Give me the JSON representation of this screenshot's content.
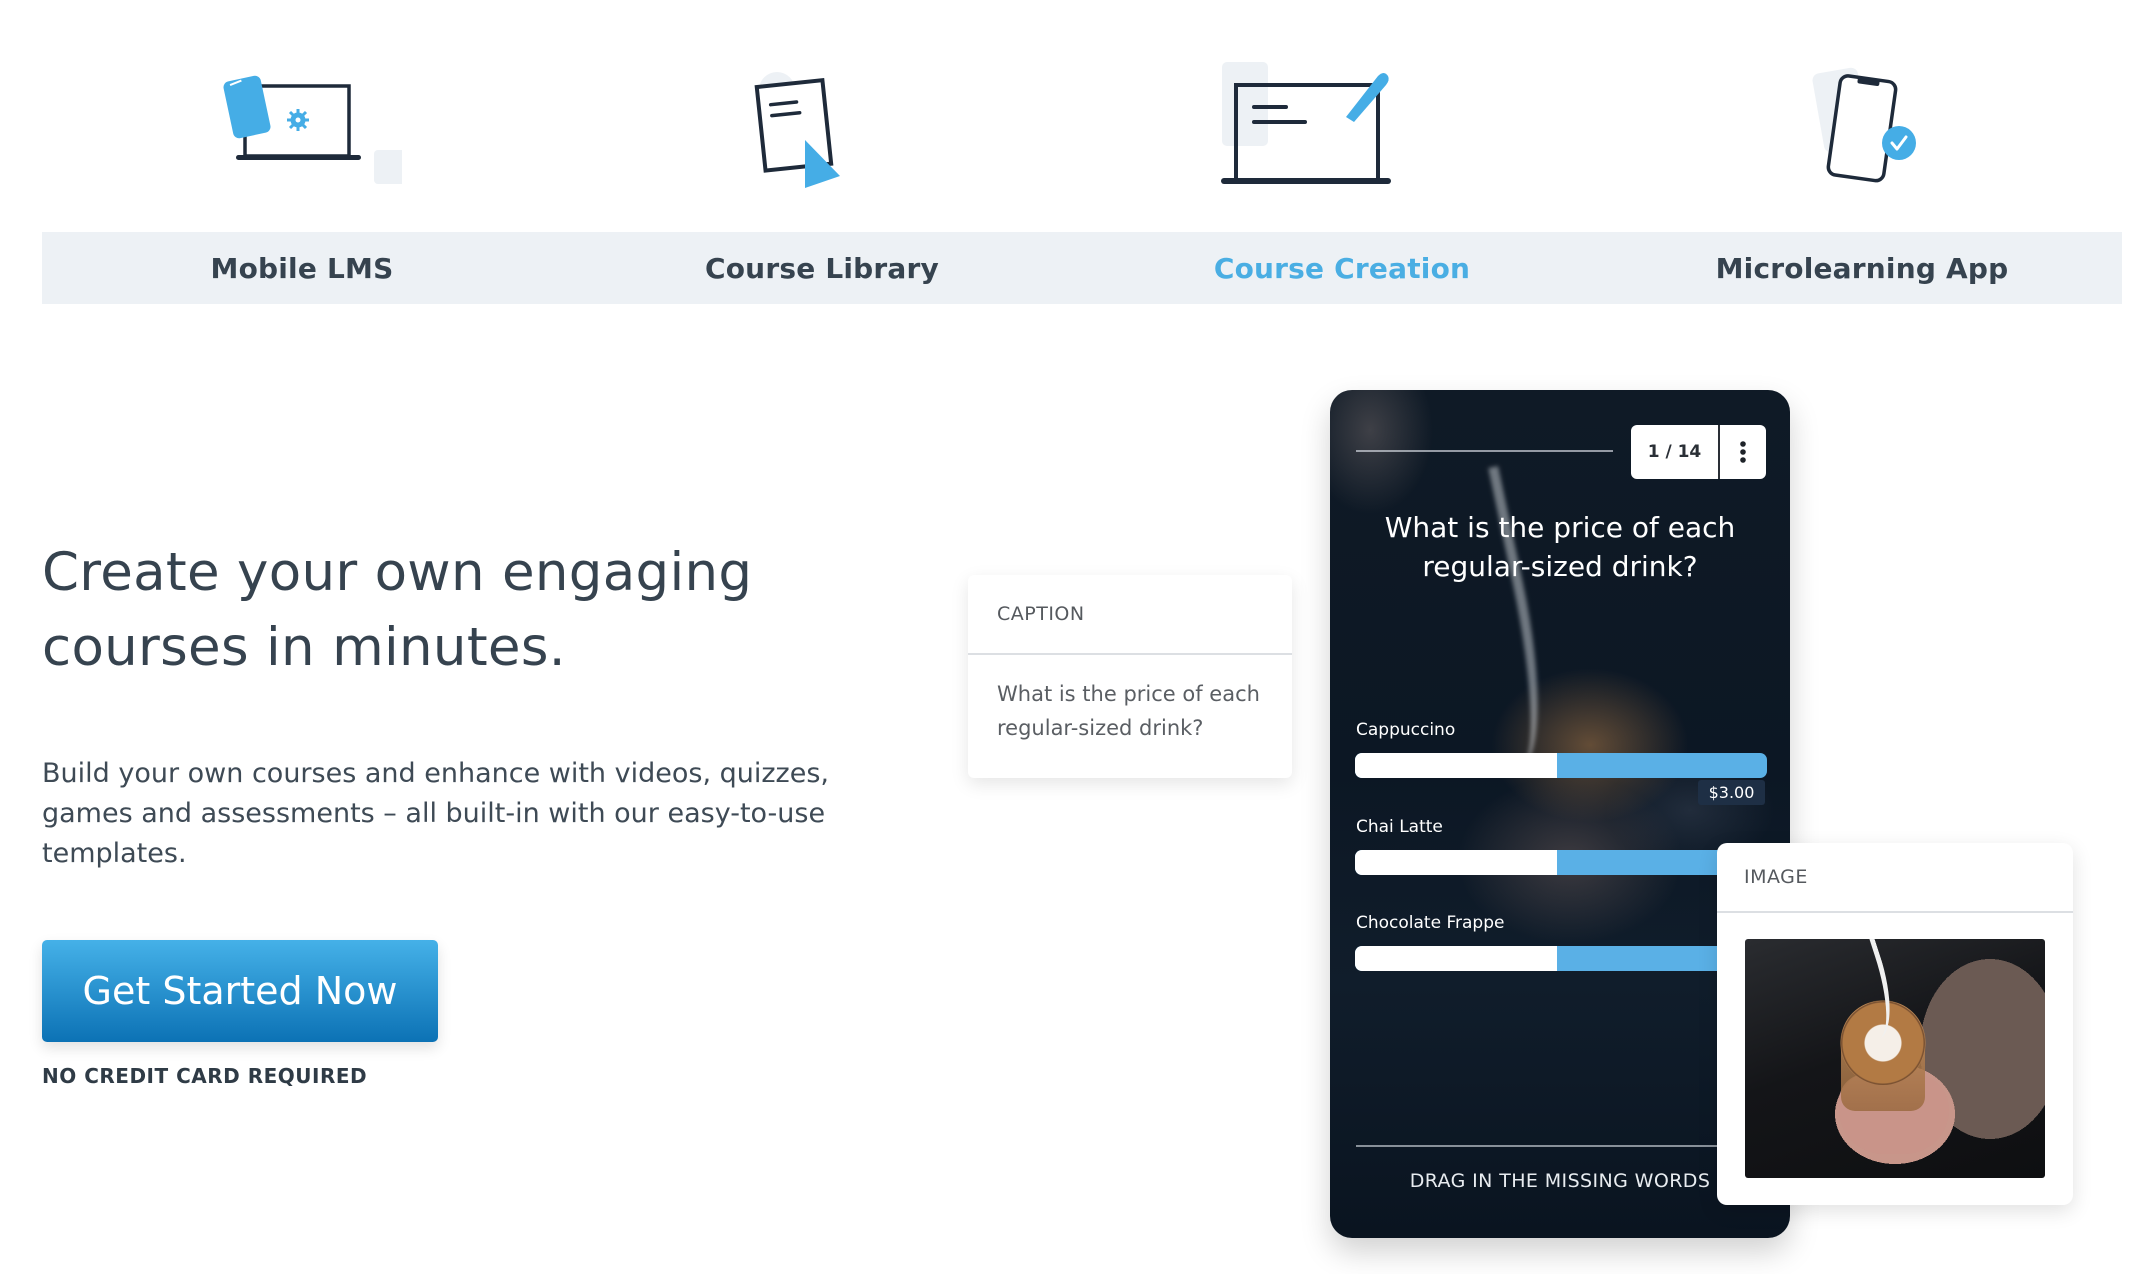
{
  "product_tabs": [
    {
      "label": "Mobile LMS",
      "icon": "laptop-phone-gear-icon",
      "active": false
    },
    {
      "label": "Course Library",
      "icon": "document-cursor-icon",
      "active": false
    },
    {
      "label": "Course Creation",
      "icon": "laptop-pen-icon",
      "active": true
    },
    {
      "label": "Microlearning App",
      "icon": "phone-check-icon",
      "active": false
    }
  ],
  "hero": {
    "title_line1": "Create your own engaging",
    "title_line2": "courses in minutes.",
    "body_line1": "Build your own courses and enhance with videos, quizzes,",
    "body_line2": "games and assessments – all built-in with our easy-to-use",
    "body_line3": "templates.",
    "cta_label": "Get Started Now",
    "cta_note": "NO CREDIT CARD REQUIRED"
  },
  "phone_preview": {
    "counter": "1 / 14",
    "menu_icon": "kebab-menu-icon",
    "question_line1": "What is the price of each",
    "question_line2": "regular-sized drink?",
    "options": [
      {
        "label": "Cappuccino",
        "slider_value": 0.49,
        "price_label": "$3.00"
      },
      {
        "label": "Chai Latte",
        "slider_value": 0.49
      },
      {
        "label": "Chocolate Frappe",
        "slider_value": 0.49
      }
    ],
    "footer": "DRAG IN THE MISSING WORDS"
  },
  "caption_card": {
    "header": "CAPTION",
    "text_line1": "What is the price of each",
    "text_line2": "regular-sized drink?"
  },
  "image_card": {
    "header": "IMAGE",
    "image_alt": "latte-art-photo"
  },
  "colors": {
    "accent": "#4aaee3",
    "text_dark": "#36434f",
    "tab_bar_bg": "#edf1f5",
    "cta_top": "#45b1e8",
    "cta_bottom": "#0c72b5",
    "icon_navy": "#1e2a3a",
    "slider_fill": "#5ab0e6"
  }
}
